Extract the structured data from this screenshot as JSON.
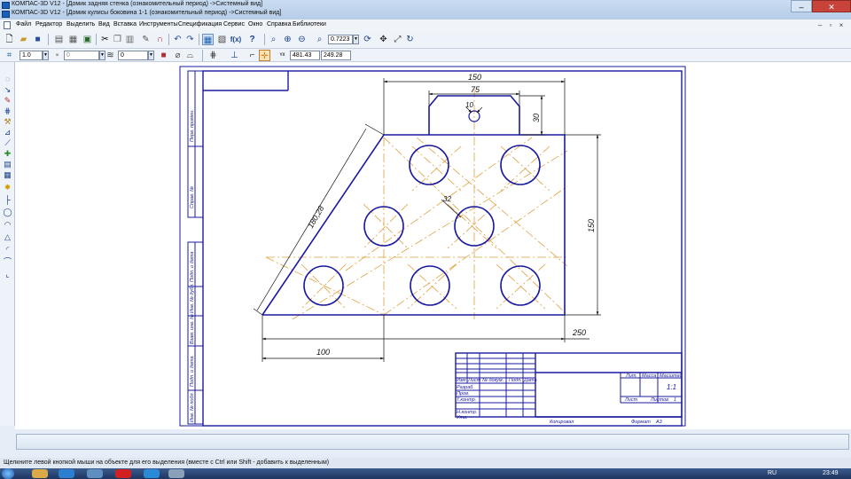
{
  "window": {
    "title_line1": "КОМПАС-3D V12 - [Домик задняя стенка (ознакомительный период) ->Системный вид]",
    "title_line2": "КОМПАС-3D V12 - [Домик кулисы боковина 1-1 (ознакомительный период) ->Системный вид]"
  },
  "menu": [
    {
      "label": "Файл"
    },
    {
      "label": "Редактор"
    },
    {
      "label": "Выделить"
    },
    {
      "label": "Вид"
    },
    {
      "label": "Вставка"
    },
    {
      "label": "Инструменты"
    },
    {
      "label": "Спецификация"
    },
    {
      "label": "Сервис"
    },
    {
      "label": "Окно"
    },
    {
      "label": "Справка"
    },
    {
      "label": "Библиотеки"
    }
  ],
  "toolbar": {
    "zoom_value": "0.7223",
    "fx_label": "f(x)",
    "line_width": "1.0",
    "style_value": "0",
    "layer_value": "0",
    "coord_x": "481.43",
    "coord_y": "249.28"
  },
  "drawing": {
    "dim_150_top": "150",
    "dim_75": "75",
    "dim_10": "10",
    "dim_30": "30",
    "dim_180_28": "180,28",
    "dim_32": "32",
    "dim_150_right": "150",
    "dim_250": "250",
    "dim_100": "100",
    "side_perv_primen": "Перв. примен.",
    "side_sprav": "Справ. №",
    "side_podp_data1": "Подп. и дата",
    "side_inv_dubl": "Инв. № дубл.",
    "side_vzam_inv": "Взам. инв. №",
    "side_podp_data2": "Подп. и дата",
    "side_inv_podl": "Инв. № подл.",
    "tb_izm": "Изм",
    "tb_list": "Лист",
    "tb_ndokum": "№ докум.",
    "tb_podp": "Подп.",
    "tb_data": "Дата",
    "tb_razrab": "Разраб.",
    "tb_prov": "Пров.",
    "tb_tkontr": "Т.контр.",
    "tb_nkontr": "Н.контр.",
    "tb_utv": "Утв.",
    "tb_lit": "Лит.",
    "tb_massa": "Масса",
    "tb_masshtab": "Масштаб",
    "tb_scale_value": "1:1",
    "tb_list2": "Лист",
    "tb_listov": "Листов",
    "tb_listov_value": "1",
    "tb_kopiroval": "Копировал",
    "tb_format": "Формат",
    "tb_format_value": "А3"
  },
  "status": {
    "hint": "Щелкните левой кнопкой мыши на объекте для его выделения (вместе с Ctrl или Shift - добавить к выделенным)"
  },
  "taskbar": {
    "lang": "RU",
    "time": "23:49"
  },
  "colors": {
    "frame_blue": "#1a1aa0",
    "axis_orange": "#e0a040",
    "dim_black": "#111111"
  }
}
